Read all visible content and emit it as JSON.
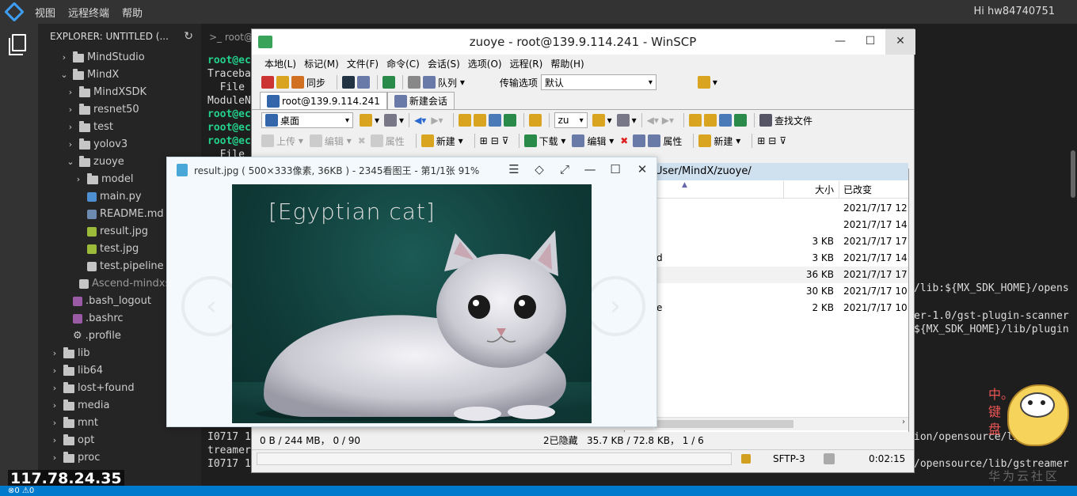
{
  "top": {
    "menu": [
      "视图",
      "远程终端",
      "帮助"
    ],
    "user": "Hi hw84740751"
  },
  "explorer": {
    "header": "EXPLORER: UNTITLED (...",
    "items": [
      {
        "label": "MindStudio",
        "type": "folder",
        "depth": 1,
        "expanded": false
      },
      {
        "label": "MindX",
        "type": "folder",
        "depth": 1,
        "expanded": true
      },
      {
        "label": "MindXSDK",
        "type": "folder",
        "depth": 2,
        "expanded": false
      },
      {
        "label": "resnet50",
        "type": "folder",
        "depth": 2,
        "expanded": false
      },
      {
        "label": "test",
        "type": "folder",
        "depth": 2,
        "expanded": false
      },
      {
        "label": "yolov3",
        "type": "folder",
        "depth": 2,
        "expanded": false
      },
      {
        "label": "zuoye",
        "type": "folder",
        "depth": 2,
        "expanded": true
      },
      {
        "label": "model",
        "type": "folder",
        "depth": 3,
        "expanded": false
      },
      {
        "label": "main.py",
        "type": "py",
        "depth": 3
      },
      {
        "label": "README.md",
        "type": "md",
        "depth": 3
      },
      {
        "label": "result.jpg",
        "type": "jpg",
        "depth": 3
      },
      {
        "label": "test.jpg",
        "type": "jpg",
        "depth": 3
      },
      {
        "label": "test.pipeline",
        "type": "txt",
        "depth": 3
      },
      {
        "label": "Ascend-mindxsdk",
        "type": "txt",
        "depth": 2
      },
      {
        "label": ".bash_logout",
        "type": "sh",
        "depth": 1
      },
      {
        "label": ".bashrc",
        "type": "sh",
        "depth": 1
      },
      {
        "label": ".profile",
        "type": "gear",
        "depth": 1
      },
      {
        "label": "lib",
        "type": "folder",
        "depth": 0,
        "expanded": false
      },
      {
        "label": "lib64",
        "type": "folder",
        "depth": 0,
        "expanded": false
      },
      {
        "label": "lost+found",
        "type": "folder",
        "depth": 0,
        "expanded": false
      },
      {
        "label": "media",
        "type": "folder",
        "depth": 0,
        "expanded": false
      },
      {
        "label": "mnt",
        "type": "folder",
        "depth": 0,
        "expanded": false
      },
      {
        "label": "opt",
        "type": "folder",
        "depth": 0,
        "expanded": false
      },
      {
        "label": "proc",
        "type": "folder",
        "depth": 0,
        "expanded": false
      }
    ]
  },
  "terminal": {
    "tab": ">_ root@",
    "left_lines": [
      {
        "text": "root@ec",
        "green": true
      },
      {
        "text": "Traceba",
        "green": false
      },
      {
        "text": "  File",
        "green": false
      },
      {
        "text": "ModuleN",
        "green": false
      },
      {
        "text": "root@ec",
        "green": true
      },
      {
        "text": "root@ec",
        "green": true
      },
      {
        "text": "root@ec",
        "green": true
      },
      {
        "text": "  File",
        "green": false
      }
    ],
    "bottom_lines": [
      "I0717 1",
      "treamer",
      "I0717 1"
    ],
    "right_lines": [
      "/lib:${MX_SDK_HOME}/opens",
      "er-1.0/gst-plugin-scanner",
      "${MX_SDK_HOME}/lib/plugin",
      "ion/opensource/lib/gs",
      "/opensource/lib/gstreamer"
    ]
  },
  "winscp": {
    "title": "zuoye - root@139.9.114.241 - WinSCP",
    "menu": [
      "本地(L)",
      "标记(M)",
      "文件(F)",
      "命令(C)",
      "会话(S)",
      "选项(O)",
      "远程(R)",
      "帮助(H)"
    ],
    "toolbar": {
      "sync": "同步",
      "queue": "队列",
      "transfer_label": "传输选项",
      "transfer_value": "默认"
    },
    "tabs": [
      "root@139.9.114.241",
      "新建会话"
    ],
    "local_path": "桌面",
    "remote_path_short": "zu",
    "find_files": "查找文件",
    "local_actions": [
      "上传",
      "编辑",
      "属性",
      "新建"
    ],
    "remote_actions": [
      "下载",
      "编辑",
      "属性",
      "新建"
    ],
    "remote_dir": "User/MindX/zuoye/",
    "columns": {
      "size": "大小",
      "modified": "已改变"
    },
    "files": [
      {
        "name": "",
        "size": "",
        "date": "2021/7/17 12:"
      },
      {
        "name": "",
        "size": "",
        "date": "2021/7/17 14:"
      },
      {
        "name": "",
        "size": "3 KB",
        "date": "2021/7/17 17:"
      },
      {
        "name": "d",
        "size": "3 KB",
        "date": "2021/7/17 14:"
      },
      {
        "name": "",
        "size": "36 KB",
        "date": "2021/7/17 17:"
      },
      {
        "name": "",
        "size": "30 KB",
        "date": "2021/7/17 10:"
      },
      {
        "name": "e",
        "size": "2 KB",
        "date": "2021/7/17 10:"
      }
    ],
    "status_left": "0 B / 244 MB，  0 / 90",
    "status_hidden": "2已隐藏",
    "status_right": "35.7 KB / 72.8 KB，  1 / 6",
    "protocol": "SFTP-3",
    "elapsed": "0:02:15"
  },
  "viewer": {
    "title": "result.jpg ( 500×333像素, 36KB ) - 2345看图王 - 第1/1张 91%",
    "label": "[Egyptian cat]"
  },
  "overlay": {
    "ip": "117.78.24.35",
    "watermark": "华为云社区",
    "ime": "中。键盘",
    "status": "⊗0 ⚠0"
  }
}
